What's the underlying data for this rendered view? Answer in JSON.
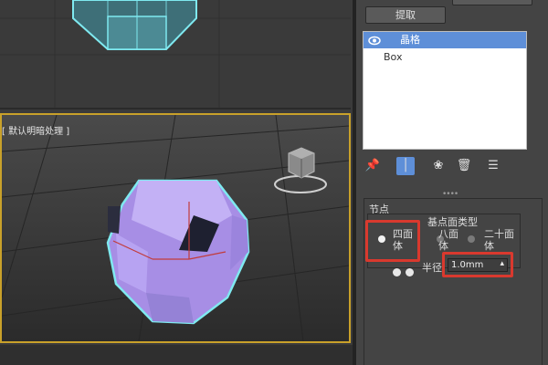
{
  "viewport": {
    "label": "[ 默认明暗处理 ]"
  },
  "panel": {
    "extract_button": "提取",
    "stack": {
      "items": [
        {
          "label": "晶格",
          "selected": true
        },
        {
          "label": "Box",
          "selected": false
        }
      ]
    },
    "group_nodes": {
      "title": "节点",
      "type_group": {
        "title": "基点面类型",
        "options": [
          {
            "label": "四面体",
            "selected": true
          },
          {
            "label": "八面体",
            "selected": false
          },
          {
            "label": "二十面体",
            "selected": false
          }
        ]
      },
      "radius_label": "半径:",
      "radius_value": "1.0mm"
    }
  },
  "colors": {
    "selection": "#5e8fd8",
    "highlight": "#d9392e",
    "active_viewport_border": "#c9a12a",
    "object": "#b69ff0",
    "object_outline": "#7fe9f0"
  },
  "icons": [
    "eye-icon",
    "pin-icon",
    "modifier-active-icon",
    "nodes-icon",
    "trash-icon",
    "config-icon",
    "viewcube-icon",
    "spinner-arrows-icon"
  ]
}
